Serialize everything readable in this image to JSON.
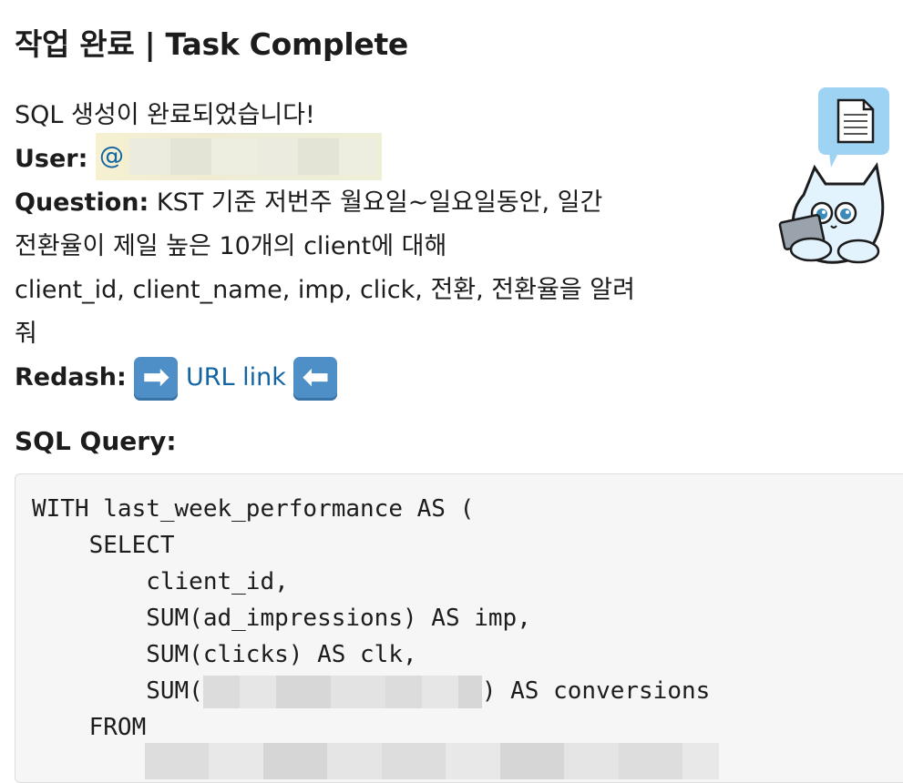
{
  "title": "작업 완료 | Task Complete",
  "message": "SQL 생성이 완료되었습니다!",
  "user": {
    "label": "User:",
    "mention": "@"
  },
  "question": {
    "label": "Question:",
    "line1": "KST 기준 저번주 월요일~일요일동안, 일간",
    "line2": "전환율이 제일 높은 10개의 client에 대해",
    "line3": "client_id, client_name, imp, click, 전환, 전환율을 알려",
    "line4": "줘"
  },
  "redash": {
    "label": "Redash:",
    "link_text": "URL link",
    "left_arrow_icon": "arrow-right-icon",
    "right_arrow_icon": "arrow-left-icon"
  },
  "sql_heading": "SQL Query:",
  "sql_lines": {
    "l1": "WITH last_week_performance AS (",
    "l2": "    SELECT",
    "l3": "        client_id,",
    "l4": "        SUM(ad_impressions) AS imp,",
    "l5": "        SUM(clicks) AS clk,",
    "l6_prefix": "        SUM(",
    "l6_suffix": ") AS conversions",
    "l7": "    FROM"
  },
  "colors": {
    "link": "#1264a3",
    "arrow": "#4e8fc7",
    "code_bg": "#f6f6f6"
  }
}
